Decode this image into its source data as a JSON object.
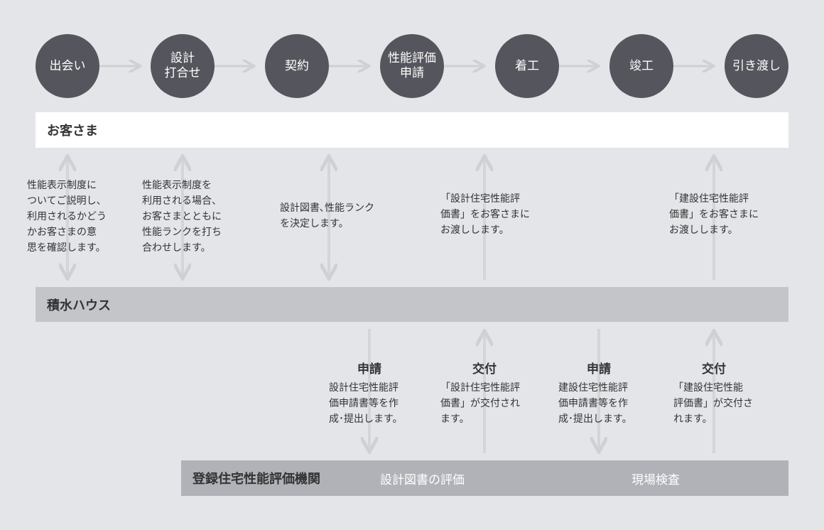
{
  "steps": [
    {
      "label": "出会い"
    },
    {
      "label": "設計\n打合せ"
    },
    {
      "label": "契約"
    },
    {
      "label": "性能評価\n申請"
    },
    {
      "label": "着工"
    },
    {
      "label": "竣工"
    },
    {
      "label": "引き渡し"
    }
  ],
  "bands": {
    "customer": "お客さま",
    "sekisui": "積水ハウス",
    "agency": "登録住宅性能評価機関",
    "agency_design_eval": "設計図書の評価",
    "agency_site_inspection": "現場検査"
  },
  "upper_texts": [
    "性能表示制度に\nついてご説明し、\n利用されるかどう\nかお客さまの意\n思を確認します。",
    "性能表示制度を\n利用される場合、\nお客さまとともに\n性能ランクを打ち\n合わせします。",
    "設計図書､性能ランク\nを決定します。",
    "「設計住宅性能評\n価書」をお客さまに\nお渡しします。",
    "「建設住宅性能評\n価書」をお客さまに\nお渡しします。"
  ],
  "lower_items": [
    {
      "heading": "申請",
      "text": "設計住宅性能評\n価申請書等を作\n成･提出します。"
    },
    {
      "heading": "交付",
      "text": "「設計住宅性能評\n価書」が交付され\nます。"
    },
    {
      "heading": "申請",
      "text": "建設住宅性能評\n価申請書等を作\n成･提出します。"
    },
    {
      "heading": "交付",
      "text": "「建設住宅性能\n評価書」が交付さ\nれます。"
    }
  ],
  "colors": {
    "background": "#e4e5e9",
    "step_circle": "#55555d",
    "arrow": "#cfd0d4",
    "band_customer": "#ffffff",
    "band_sekisui": "#c3c5c9",
    "band_agency": "#b1b2b8"
  }
}
